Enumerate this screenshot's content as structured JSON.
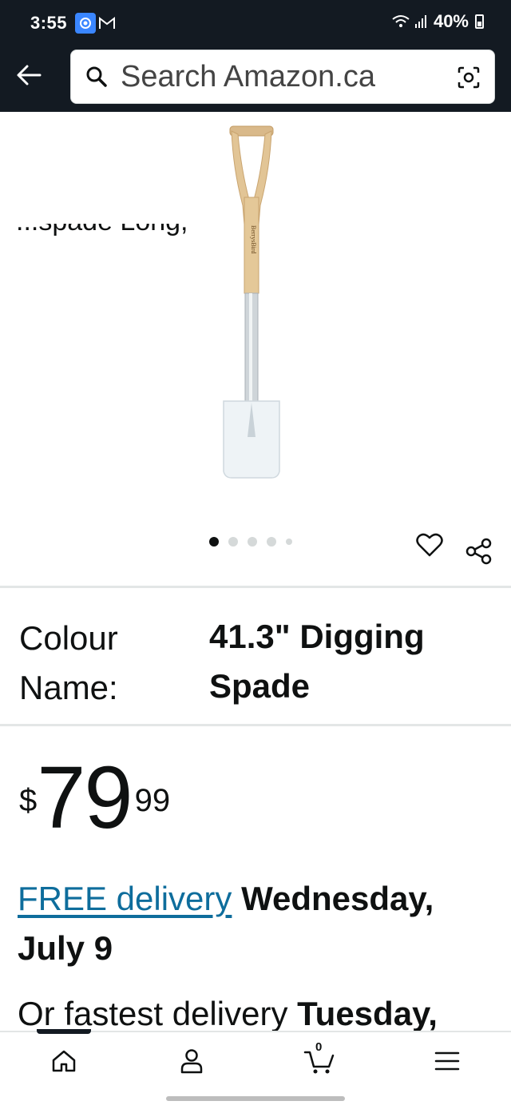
{
  "status_bar": {
    "time": "3:55",
    "battery": "40%"
  },
  "header": {
    "search_placeholder": "Search Amazon.ca"
  },
  "product": {
    "title_peek": "...spade Long,",
    "brand_on_handle": "BerrysBird",
    "image_count": 5,
    "active_image_index": 0,
    "colour_label": "Colour Name:",
    "colour_value": "41.3\" Digging Spade",
    "price": {
      "symbol": "$",
      "whole": "79",
      "fraction": "99"
    },
    "delivery": {
      "link": "FREE delivery",
      "date": "Wednesday, July 9"
    },
    "fastest": {
      "prefix": "Or fastest delivery",
      "date": "Tuesday,"
    }
  },
  "bottom_nav": {
    "cart_count": "0"
  },
  "colors": {
    "header_bg": "#131a22",
    "link": "#0e6d9c",
    "text": "#0f1111"
  }
}
